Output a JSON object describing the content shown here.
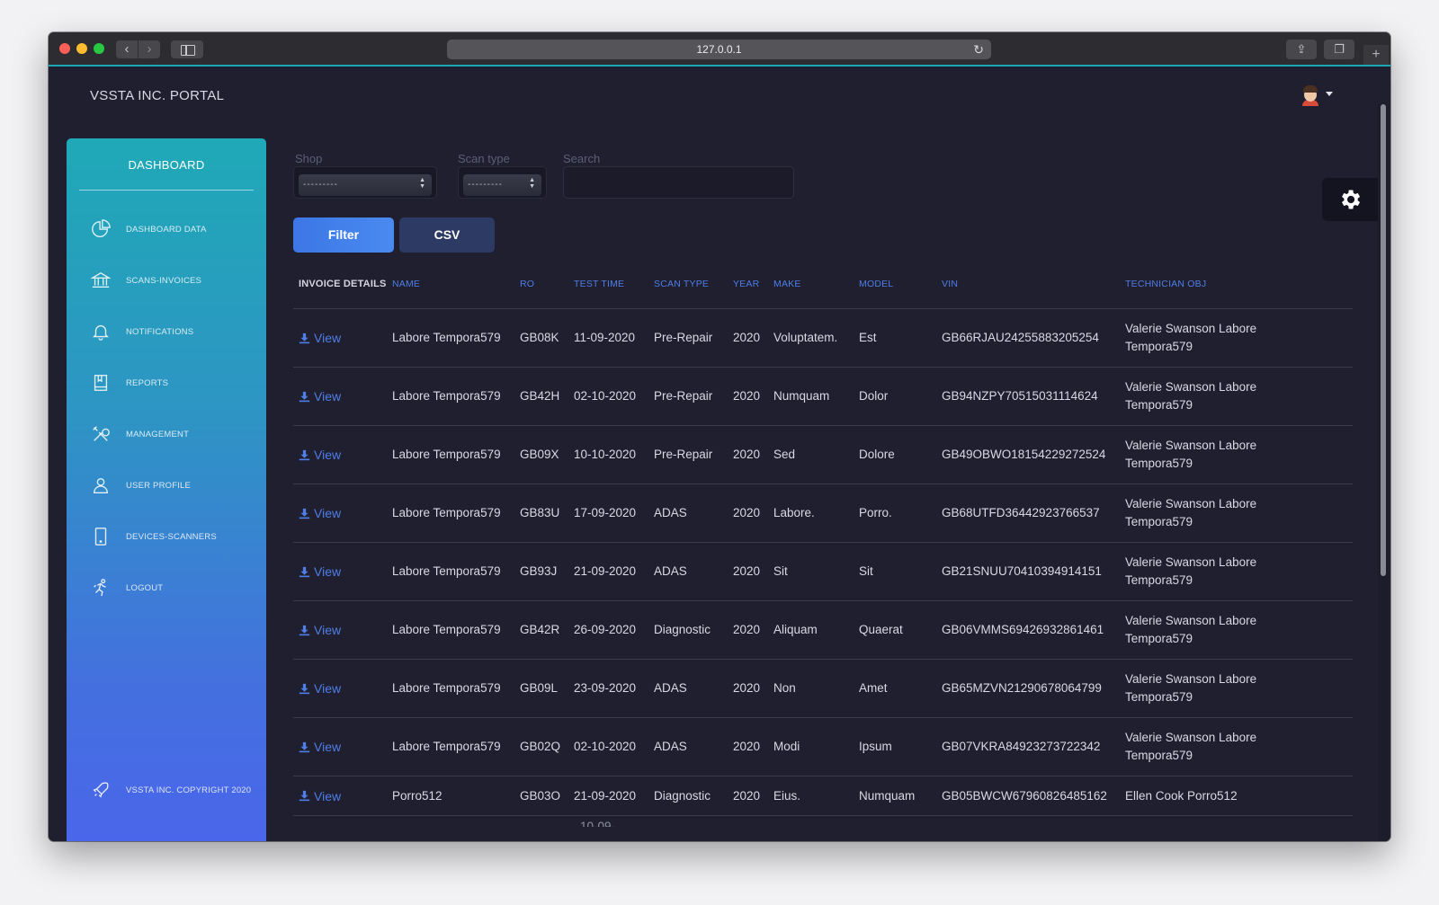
{
  "browser": {
    "url": "127.0.0.1"
  },
  "header": {
    "brand": "VSSTA INC. PORTAL"
  },
  "sidebar": {
    "title": "DASHBOARD",
    "items": [
      {
        "label": "DASHBOARD DATA",
        "icon": "pie-chart-icon"
      },
      {
        "label": "SCANS-INVOICES",
        "icon": "bank-icon"
      },
      {
        "label": "NOTIFICATIONS",
        "icon": "bell-icon"
      },
      {
        "label": "REPORTS",
        "icon": "book-icon"
      },
      {
        "label": "MANAGEMENT",
        "icon": "tools-icon"
      },
      {
        "label": "USER PROFILE",
        "icon": "user-icon"
      },
      {
        "label": "DEVICES-SCANNERS",
        "icon": "mobile-icon"
      },
      {
        "label": "LOGOUT",
        "icon": "running-person-icon"
      }
    ],
    "footer": "VSSTA INC. COPYRIGHT 2020"
  },
  "filters": {
    "shop_label": "Shop",
    "shop_value": "---------",
    "scan_type_label": "Scan type",
    "scan_type_value": "---------",
    "search_label": "Search",
    "search_value": "",
    "filter_button": "Filter",
    "csv_button": "CSV"
  },
  "table": {
    "columns": [
      "INVOICE DETAILS",
      "NAME",
      "RO",
      "TEST TIME",
      "SCAN TYPE",
      "YEAR",
      "MAKE",
      "MODEL",
      "VIN",
      "TECHNICIAN OBJ"
    ],
    "rows": [
      {
        "invoice": "View",
        "name": "Labore Tempora579",
        "ro": "GB08K",
        "test_time": "11-09-2020",
        "scan_type": "Pre-Repair",
        "year": "2020",
        "make": "Voluptatem.",
        "model": "Est",
        "vin": "GB66RJAU24255883205254",
        "technician": "Valerie Swanson Labore Tempora579"
      },
      {
        "invoice": "View",
        "name": "Labore Tempora579",
        "ro": "GB42H",
        "test_time": "02-10-2020",
        "scan_type": "Pre-Repair",
        "year": "2020",
        "make": "Numquam",
        "model": "Dolor",
        "vin": "GB94NZPY70515031114624",
        "technician": "Valerie Swanson Labore Tempora579"
      },
      {
        "invoice": "View",
        "name": "Labore Tempora579",
        "ro": "GB09X",
        "test_time": "10-10-2020",
        "scan_type": "Pre-Repair",
        "year": "2020",
        "make": "Sed",
        "model": "Dolore",
        "vin": "GB49OBWO18154229272524",
        "technician": "Valerie Swanson Labore Tempora579"
      },
      {
        "invoice": "View",
        "name": "Labore Tempora579",
        "ro": "GB83U",
        "test_time": "17-09-2020",
        "scan_type": "ADAS",
        "year": "2020",
        "make": "Labore.",
        "model": "Porro.",
        "vin": "GB68UTFD36442923766537",
        "technician": "Valerie Swanson Labore Tempora579"
      },
      {
        "invoice": "View",
        "name": "Labore Tempora579",
        "ro": "GB93J",
        "test_time": "21-09-2020",
        "scan_type": "ADAS",
        "year": "2020",
        "make": "Sit",
        "model": "Sit",
        "vin": "GB21SNUU70410394914151",
        "technician": "Valerie Swanson Labore Tempora579"
      },
      {
        "invoice": "View",
        "name": "Labore Tempora579",
        "ro": "GB42R",
        "test_time": "26-09-2020",
        "scan_type": "Diagnostic",
        "year": "2020",
        "make": "Aliquam",
        "model": "Quaerat",
        "vin": "GB06VMMS69426932861461",
        "technician": "Valerie Swanson Labore Tempora579"
      },
      {
        "invoice": "View",
        "name": "Labore Tempora579",
        "ro": "GB09L",
        "test_time": "23-09-2020",
        "scan_type": "ADAS",
        "year": "2020",
        "make": "Non",
        "model": "Amet",
        "vin": "GB65MZVN21290678064799",
        "technician": "Valerie Swanson Labore Tempora579"
      },
      {
        "invoice": "View",
        "name": "Labore Tempora579",
        "ro": "GB02Q",
        "test_time": "02-10-2020",
        "scan_type": "ADAS",
        "year": "2020",
        "make": "Modi",
        "model": "Ipsum",
        "vin": "GB07VKRA84923273722342",
        "technician": "Valerie Swanson Labore Tempora579"
      },
      {
        "invoice": "View",
        "name": "Porro512",
        "ro": "GB03O",
        "test_time": "21-09-2020",
        "scan_type": "Diagnostic",
        "year": "2020",
        "make": "Eius.",
        "model": "Numquam",
        "vin": "GB05BWCW67960826485162",
        "technician": "Ellen Cook Porro512"
      }
    ],
    "partial_next_row_text": "10-09-"
  },
  "colors": {
    "page_bg": "#1f1f30",
    "accent_blue": "#4f7ee6",
    "sidebar_top": "#1fa9b7",
    "sidebar_bottom": "#4a66ea"
  }
}
